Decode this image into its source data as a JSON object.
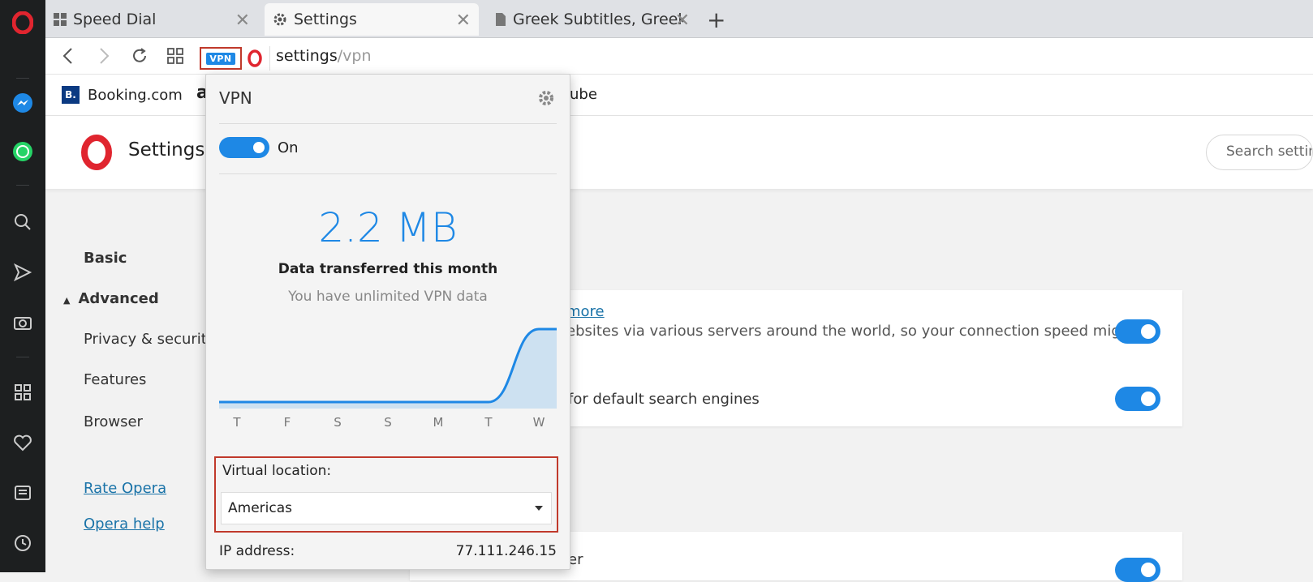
{
  "tabs": [
    {
      "label": "Speed Dial",
      "icon": "grid-icon"
    },
    {
      "label": "Settings",
      "icon": "gear-icon"
    },
    {
      "label": "Greek Subtitles, Greek",
      "icon": "document-icon"
    }
  ],
  "address": {
    "vpn_badge": "VPN",
    "url_main": "settings",
    "url_path": "/vpn"
  },
  "bookmarks": [
    {
      "label": "Booking.com",
      "icon_letter": "B."
    },
    {
      "label": "a"
    },
    {
      "label": "ube"
    }
  ],
  "settings": {
    "title": "Settings",
    "search_placeholder": "Search settings",
    "nav": {
      "basic": "Basic",
      "advanced": "Advanced",
      "privacy": "Privacy & security",
      "features": "Features",
      "browser": "Browser",
      "rate": "Rate Opera",
      "help": "Opera help"
    },
    "card1": {
      "link": "more",
      "text": "ebsites via various servers around the world, so your connection speed might"
    },
    "card1_row2": "for default search engines",
    "card2_text": "er"
  },
  "vpn": {
    "title": "VPN",
    "state": "On",
    "data_amount": "2.2 MB",
    "data_label": "Data transferred this month",
    "data_sub": "You have unlimited VPN data",
    "days": [
      "T",
      "F",
      "S",
      "S",
      "M",
      "T",
      "W"
    ],
    "usage": [
      0,
      0,
      0,
      0,
      0,
      0,
      2.2
    ],
    "location_label": "Virtual location:",
    "location_value": "Americas",
    "ip_label": "IP address:",
    "ip_value": "77.111.246.15"
  },
  "colors": {
    "accent": "#1e88e5",
    "highlight": "#c0392b",
    "opera": "#e0252f"
  }
}
